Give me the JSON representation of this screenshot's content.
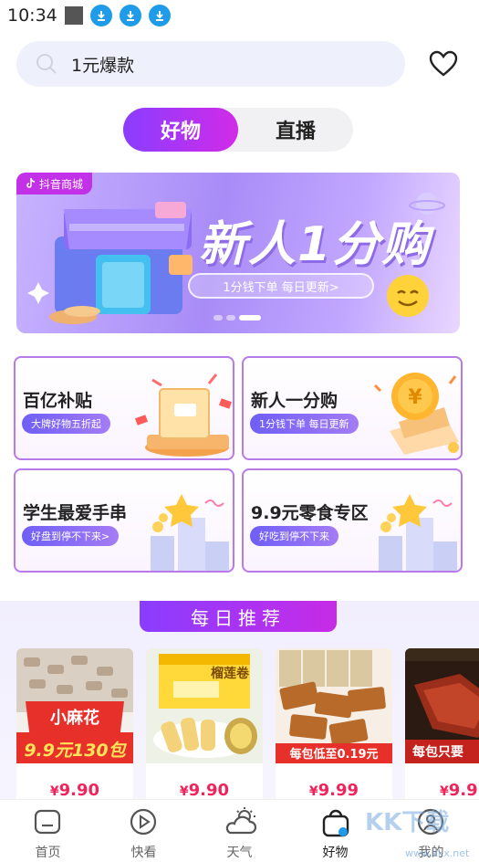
{
  "status_bar": {
    "time": "10:34"
  },
  "search": {
    "query": "1元爆款"
  },
  "tabs": [
    {
      "label": "好物"
    },
    {
      "label": "直播"
    }
  ],
  "banner": {
    "tag": "抖音商城",
    "headline": "新人1分购",
    "subtitle": "1分钱下单 每日更新>"
  },
  "cards": [
    {
      "title": "百亿补贴",
      "subtitle": "大牌好物五折起"
    },
    {
      "title": "新人一分购",
      "subtitle": "1分钱下单 每日更新"
    },
    {
      "title": "学生最爱手串",
      "subtitle": "好盘到停不下来>"
    },
    {
      "title": "9.9元零食专区",
      "subtitle": "好吃到停不下来"
    }
  ],
  "daily": {
    "title": "每日推荐",
    "products": [
      {
        "image_text_1": "小麻花",
        "image_text_2": "9.9元130包",
        "currency": "¥",
        "price": "9.90"
      },
      {
        "image_text_1": "榴莲卷",
        "image_text_2": "",
        "currency": "¥",
        "price": "9.90"
      },
      {
        "image_text_1": "每包低至0.19元",
        "image_text_2": "",
        "currency": "¥",
        "price": "9.99"
      },
      {
        "image_text_1": "每包只要",
        "image_text_2": "",
        "currency": "¥",
        "price": "9.9"
      }
    ]
  },
  "nav": [
    {
      "label": "首页"
    },
    {
      "label": "快看"
    },
    {
      "label": "天气"
    },
    {
      "label": "好物"
    },
    {
      "label": "我的"
    }
  ],
  "watermark": {
    "text": "KK下载",
    "url": "www.kkx.net"
  },
  "colors": {
    "accent": "#8a3dff",
    "accent_end": "#d12be8",
    "price": "#f0245a",
    "status_icon": "#1e9be9"
  }
}
